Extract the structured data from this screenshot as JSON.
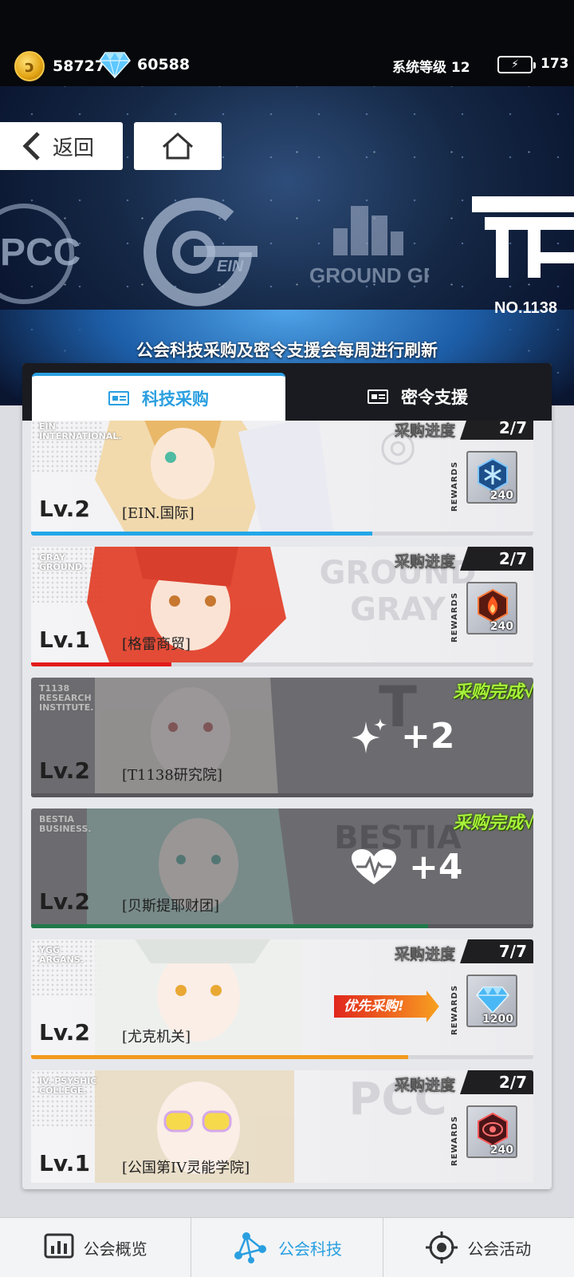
{
  "header": {
    "gold_amount": "58727",
    "gem_amount": "60588",
    "system_level": "系统等级 12",
    "energy_amount": "173"
  },
  "banner": {
    "back_label": "返回",
    "notice": "公会科技采购及密令支援会每周进行刷新",
    "logos": [
      "PCC",
      "EIN",
      "GROUND GRAY",
      "NO.1138"
    ]
  },
  "tabs": [
    {
      "label": "科技采购",
      "active": true
    },
    {
      "label": "密令支援",
      "active": false
    }
  ],
  "progress_label": "采购进度",
  "rewards_label": "REWARDS",
  "done_label": "采购完成√",
  "priority_label": "优先采购!",
  "cards": [
    {
      "tag": "EIN\nINTERNATIONAL.",
      "level": "Lv.2",
      "name": "[EIN.国际]",
      "progress": "2/7",
      "reward_value": "240",
      "reward_icon": "snowflake-gem-icon",
      "bar_color": "#22a7e8",
      "bar_fraction": 0.68
    },
    {
      "tag": "GRAY\nGROUND.",
      "level": "Lv.1",
      "name": "[格雷商贸]",
      "progress": "2/7",
      "reward_value": "240",
      "reward_icon": "flame-gem-icon",
      "bar_color": "#e21b1b",
      "bar_fraction": 0.28
    },
    {
      "tag": "T1138\nRESEARCH\nINSTITUTE.",
      "level": "Lv.2",
      "name": "[T1138研究院]",
      "completed": true,
      "bonus": "+2",
      "bonus_icon": "sparkle-icon"
    },
    {
      "tag": "BESTIA\nBUSINESS.",
      "level": "Lv.2",
      "name": "[贝斯提耶财团]",
      "completed": true,
      "bonus": "+4",
      "bonus_icon": "heartbeat-icon",
      "bar_color": "#1f7a4a",
      "bar_fraction": 0.79
    },
    {
      "tag": "YGG\nARGANS.",
      "level": "Lv.2",
      "name": "[尤克机关]",
      "progress": "7/7",
      "reward_value": "1200",
      "reward_icon": "diamond-icon",
      "priority": true,
      "bar_color": "#f29a1c",
      "bar_fraction": 0.75
    },
    {
      "tag": "IV. PSYSHIC\nCOLLEGE.",
      "level": "Lv.1",
      "name": "[公国第IV灵能学院]",
      "progress": "2/7",
      "reward_value": "240",
      "reward_icon": "eye-gem-icon"
    }
  ],
  "bottom_nav": [
    {
      "label": "公会概览",
      "icon": "chart-icon"
    },
    {
      "label": "公会科技",
      "icon": "network-icon",
      "active": true
    },
    {
      "label": "公会活动",
      "icon": "target-icon"
    }
  ]
}
